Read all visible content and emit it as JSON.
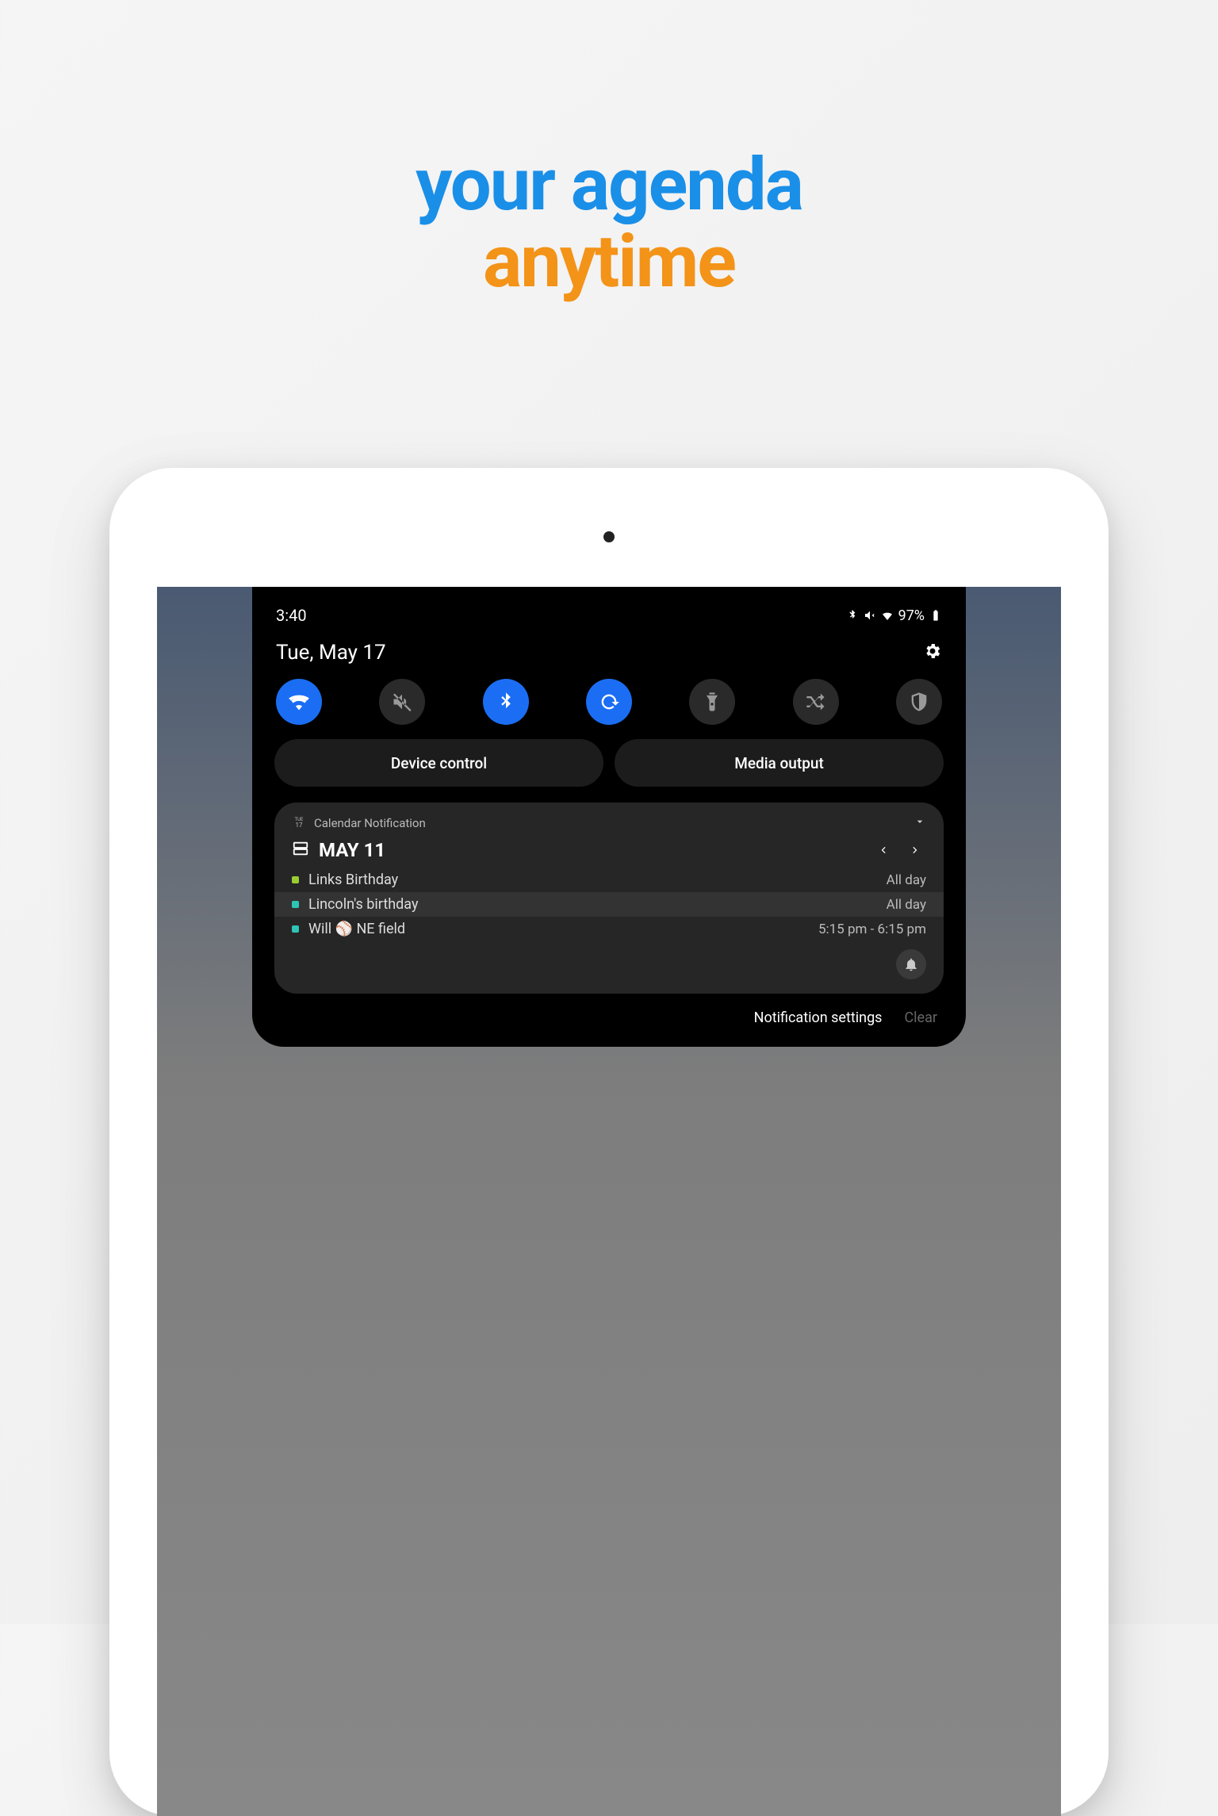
{
  "hero": {
    "line1": "your agenda",
    "line2": "anytime"
  },
  "status": {
    "time": "3:40",
    "battery": "97%"
  },
  "shade": {
    "date": "Tue, May 17",
    "device_control": "Device control",
    "media_output": "Media output"
  },
  "notification": {
    "app_name": "Calendar Notification",
    "app_icon_day": "17",
    "app_icon_dow": "TUE",
    "title_date": "MAY 11",
    "events": [
      {
        "title": "Links Birthday",
        "time": "All day",
        "color": "#9acd32",
        "highlighted": false
      },
      {
        "title": "Lincoln's birthday",
        "time": "All day",
        "color": "#2ec4b6",
        "highlighted": true
      },
      {
        "title": "Will ⚾ NE field",
        "time": "5:15 pm - 6:15 pm",
        "color": "#2ec4b6",
        "highlighted": false
      }
    ]
  },
  "footer": {
    "settings": "Notification settings",
    "clear": "Clear"
  }
}
